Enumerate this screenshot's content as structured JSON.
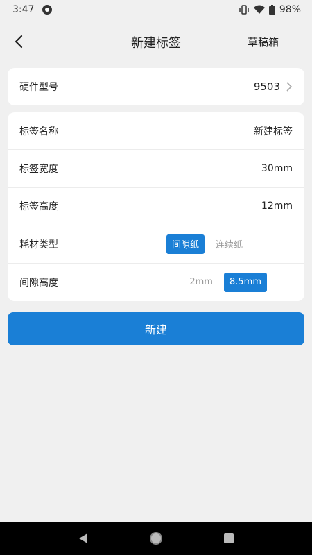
{
  "status_bar": {
    "time": "3:47",
    "battery": "98%",
    "icons": [
      "app-notification-icon",
      "vibrate-icon",
      "wifi-icon",
      "battery-icon"
    ]
  },
  "header": {
    "title": "新建标签",
    "drafts_label": "草稿箱",
    "back_icon": "back-chevron-icon"
  },
  "hardware": {
    "label": "硬件型号",
    "value": "9503"
  },
  "properties": {
    "name": {
      "label": "标签名称",
      "value": "新建标签"
    },
    "width": {
      "label": "标签宽度",
      "value": "30mm"
    },
    "height": {
      "label": "标签高度",
      "value": "12mm"
    },
    "consumable": {
      "label": "耗材类型",
      "options": [
        "间隙纸",
        "连续纸"
      ],
      "selected": "间隙纸"
    },
    "gap": {
      "label": "间隙高度",
      "options": [
        "2mm",
        "8.5mm"
      ],
      "selected": "8.5mm"
    }
  },
  "create_button": "新建",
  "colors": {
    "accent": "#1a7fd6",
    "background": "#f0f0f0",
    "card": "#ffffff",
    "muted_text": "#999999"
  }
}
